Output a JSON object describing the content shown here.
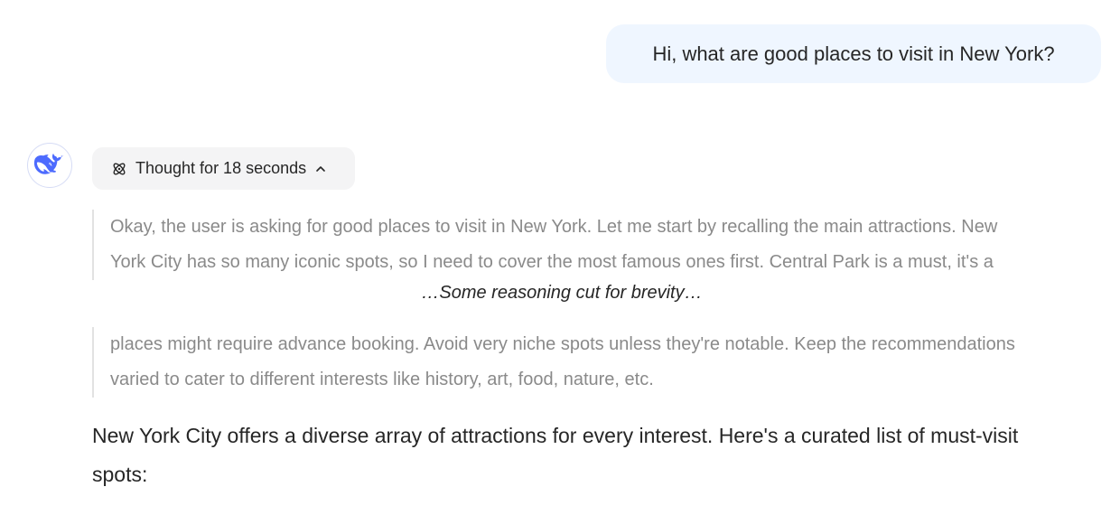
{
  "user_message": {
    "text": "Hi, what are good places to visit in New York?"
  },
  "assistant": {
    "avatar_icon": "deepseek-whale-logo",
    "thought_toggle": {
      "label": "Thought for 18 seconds",
      "icon": "atom-icon",
      "state_icon": "chevron-up-icon"
    },
    "reasoning_top": [
      "Okay, the user is asking for good places to visit in New York. Let me start by recalling the main attractions. New",
      "York City has so many iconic spots, so I need to cover the most famous ones first. Central Park is a must, it's a"
    ],
    "cut_note": "…Some reasoning cut for brevity…",
    "reasoning_bottom": [
      "places might require advance booking. Avoid very niche spots unless they're notable. Keep the recommendations",
      "varied to cater to different interests like history, art, food, nature, etc."
    ],
    "answer": [
      "New York City offers a diverse array of attractions for every interest. Here's a curated list of must-visit",
      "spots:"
    ]
  },
  "colors": {
    "user_bubble_bg": "#eff6ff",
    "brand_blue": "#4d6bfe",
    "chip_bg": "#f4f4f5",
    "reasoning_text": "#8a8a8a",
    "reasoning_border": "#e2e2e2",
    "body_text": "#262626"
  }
}
